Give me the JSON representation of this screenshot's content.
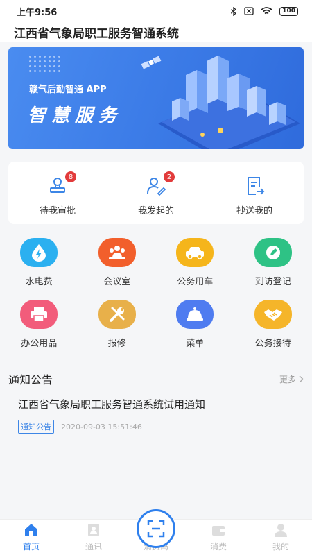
{
  "status_bar": {
    "time": "上午9:56",
    "battery": "100"
  },
  "app": {
    "title": "江西省气象局职工服务智通系统"
  },
  "banner": {
    "subtitle": "赣气后勤智通 APP",
    "headline": "智慧服务"
  },
  "approvals": [
    {
      "label": "待我审批",
      "icon": "stamp-icon",
      "badge": "8"
    },
    {
      "label": "我发起的",
      "icon": "user-edit-icon",
      "badge": "2"
    },
    {
      "label": "抄送我的",
      "icon": "document-forward-icon",
      "badge": ""
    }
  ],
  "services": [
    {
      "label": "水电费",
      "icon": "water-drop-bolt-icon",
      "color": "#2bb0f0"
    },
    {
      "label": "会议室",
      "icon": "meeting-people-icon",
      "color": "#f25f2c"
    },
    {
      "label": "公务用车",
      "icon": "car-icon",
      "color": "#f5b51b"
    },
    {
      "label": "到访登记",
      "icon": "pencil-icon",
      "color": "#2ec285"
    },
    {
      "label": "办公用品",
      "icon": "printer-icon",
      "color": "#f25c7b"
    },
    {
      "label": "报修",
      "icon": "tools-icon",
      "color": "#e8b04a"
    },
    {
      "label": "菜单",
      "icon": "food-cloche-icon",
      "color": "#4f7cf0"
    },
    {
      "label": "公务接待",
      "icon": "handshake-icon",
      "color": "#f5b52a"
    }
  ],
  "notices": {
    "title": "通知公告",
    "more": "更多",
    "items": [
      {
        "text": "江西省气象局职工服务智通系统试用通知",
        "tag": "通知公告",
        "date": "2020-09-03 15:51:46"
      }
    ]
  },
  "tabbar": {
    "tabs": [
      {
        "label": "首页",
        "icon": "home-icon",
        "active": true
      },
      {
        "label": "通讯",
        "icon": "contacts-icon",
        "active": false
      },
      {
        "label": "消费码",
        "icon": "scan-code-icon",
        "active": false
      },
      {
        "label": "消费",
        "icon": "wallet-icon",
        "active": false
      },
      {
        "label": "我的",
        "icon": "person-icon",
        "active": false
      }
    ]
  },
  "colors": {
    "accent": "#2f80ed",
    "badge": "#e23b3b"
  }
}
